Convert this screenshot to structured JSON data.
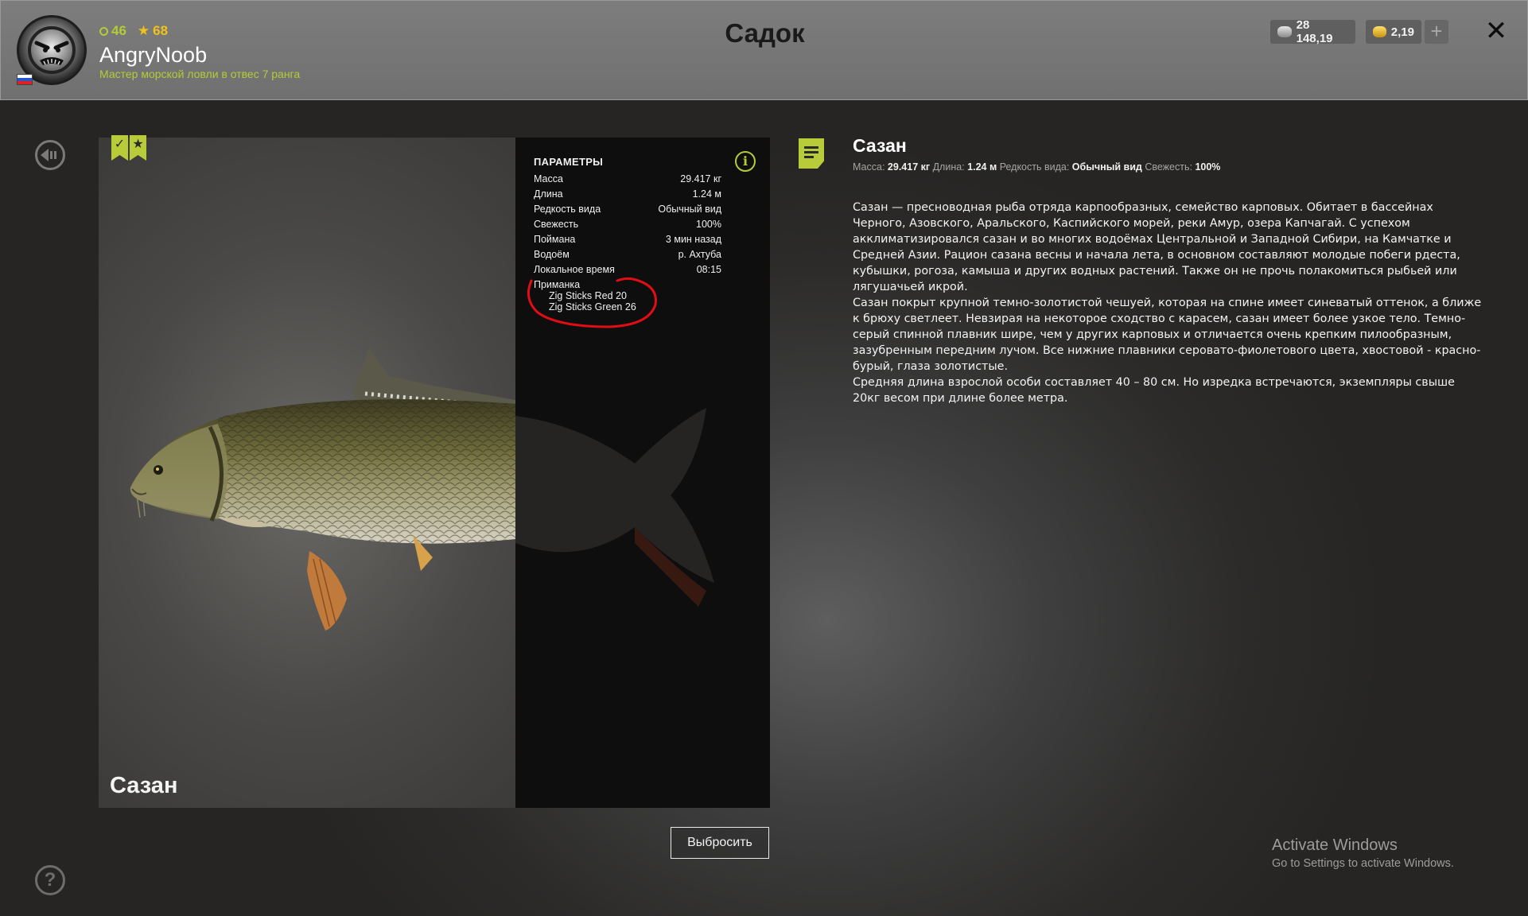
{
  "header": {
    "title": "Садок",
    "user": {
      "level": "46",
      "rank": "68",
      "name": "AngryNoob",
      "title": "Мастер морской ловли в отвес 7 ранга"
    },
    "currency": {
      "silver": "28 148,19",
      "gold": "2,19"
    },
    "plus_label": "+",
    "close_label": "✕"
  },
  "fish_view": {
    "name": "Сазан"
  },
  "params": {
    "title": "ПАРАМЕТРЫ",
    "rows": [
      {
        "label": "Масса",
        "value": "29.417 кг"
      },
      {
        "label": "Длина",
        "value": "1.24 м"
      },
      {
        "label": "Редкость вида",
        "value": "Обычный вид"
      },
      {
        "label": "Свежесть",
        "value": "100%"
      },
      {
        "label": "Поймана",
        "value": "3 мин назад"
      },
      {
        "label": "Водоём",
        "value": "р. Ахтуба"
      },
      {
        "label": "Локальное время",
        "value": "08:15"
      }
    ],
    "lure_label": "Приманка",
    "lures": [
      "Zig Sticks Red 20",
      "Zig Sticks Green 26"
    ],
    "info_label": "i"
  },
  "description": {
    "title": "Сазан",
    "meta": {
      "mass_label": "Масса:",
      "mass": "29.417 кг",
      "length_label": "Длина:",
      "length": "1.24 м",
      "rarity_label": "Редкость вида:",
      "rarity": "Обычный вид",
      "freshness_label": "Свежесть:",
      "freshness": "100%"
    },
    "paragraphs": [
      "Сазан — пресноводная рыба отряда карпообразных, семейство карповых. Обитает в бассейнах Черного, Азовского, Аральского, Каспийского морей, реки Амур, озера Капчагай. С успехом акклиматизировался сазан и во многих водоёмах Центральной и Западной Сибири, на Камчатке и Средней Азии. Рацион сазана весны и начала лета, в основном составляют молодые побеги рдеста, кубышки, рогоза, камыша и других водных растений. Также он не прочь полакомиться рыбьей или лягушачьей икрой.",
      "Сазан покрыт крупной темно-золотистой чешуей, которая на спине имеет синеватый оттенок, а ближе к брюху светлеет. Невзирая на некоторое сходство с карасем, сазан имеет более узкое тело. Темно-серый спинной плавник шире, чем у других карповых и отличается очень крепким пилообразным, зазубренным передним лучом. Все нижние плавники серовато-фиолетового цвета, хвостовой - красно-бурый, глаза золотистые.",
      "Средняя длина взрослой особи составляет 40 – 80 см. Но изредка встречаются, экземпляры свыше 20кг весом при длине более метра."
    ]
  },
  "actions": {
    "discard": "Выбросить"
  },
  "icons": {
    "back": "back-arrow-icon",
    "help": "help-icon",
    "help_glyph": "?",
    "note": "note-icon",
    "info": "info-icon"
  },
  "watermark": {
    "line1": "Activate Windows",
    "line2": "Go to Settings to activate Windows."
  },
  "colors": {
    "accent_green": "#b3cc37",
    "accent_gold": "#f0c21a"
  }
}
